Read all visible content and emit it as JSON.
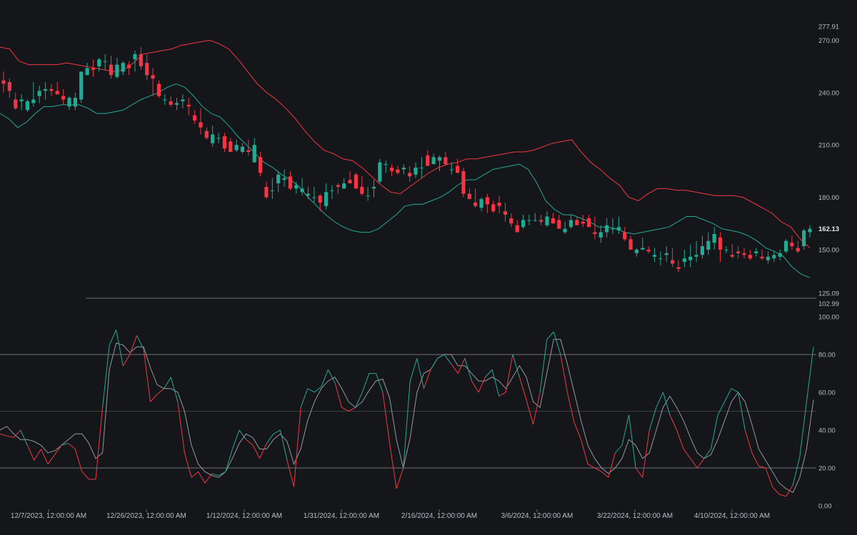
{
  "colors": {
    "background": "#151619",
    "up": "#22ab94",
    "down": "#f23645",
    "upper_band": "#f23645",
    "lower_band": "#22ab94",
    "k_up": "#22ab94",
    "k_down": "#f23645",
    "d_line": "#9598a1",
    "level_line": "#787b86"
  },
  "chart_data": [
    {
      "type": "candlestick",
      "panel": "price",
      "y_ticks": [
        "277.91",
        "270.00",
        "240.00",
        "210.00",
        "180.00",
        "150.00",
        "125.09"
      ],
      "ylim": [
        125.09,
        277.91
      ],
      "last_price_label": "162.13",
      "ohlc": [
        [
          247,
          252,
          240,
          245
        ],
        [
          246,
          248,
          237,
          241
        ],
        [
          236,
          240,
          230,
          231
        ],
        [
          235,
          239,
          230,
          236
        ],
        [
          230,
          236,
          229,
          235
        ],
        [
          234,
          246,
          232,
          236
        ],
        [
          238,
          244,
          234,
          241
        ],
        [
          241,
          246,
          236,
          242
        ],
        [
          242,
          245,
          238,
          241
        ],
        [
          241,
          246,
          239,
          239
        ],
        [
          238,
          242,
          233,
          236
        ],
        [
          232,
          238,
          230,
          237
        ],
        [
          232,
          240,
          230,
          237
        ],
        [
          236,
          250,
          234,
          252
        ],
        [
          250,
          257,
          250,
          254
        ],
        [
          254,
          259,
          249,
          253
        ],
        [
          255,
          260,
          252,
          259
        ],
        [
          258,
          262,
          253,
          258
        ],
        [
          256,
          261,
          248,
          250
        ],
        [
          249,
          260,
          248,
          256
        ],
        [
          252,
          258,
          250,
          257
        ],
        [
          256,
          258,
          250,
          254
        ],
        [
          259,
          264,
          252,
          262
        ],
        [
          262,
          266,
          253,
          255
        ],
        [
          257,
          262,
          247,
          250
        ],
        [
          250,
          254,
          238,
          248
        ],
        [
          245,
          247,
          237,
          238
        ],
        [
          236,
          239,
          233,
          236
        ],
        [
          235,
          238,
          232,
          233
        ],
        [
          233,
          237,
          230,
          234
        ],
        [
          235,
          239,
          231,
          236
        ],
        [
          233,
          237,
          227,
          232
        ],
        [
          227,
          230,
          222,
          224
        ],
        [
          223,
          231,
          216,
          220
        ],
        [
          218,
          220,
          213,
          214
        ],
        [
          211,
          221,
          209,
          216
        ],
        [
          214,
          217,
          211,
          214
        ],
        [
          215,
          217,
          206,
          208
        ],
        [
          212,
          214,
          208,
          206
        ],
        [
          207,
          213,
          206,
          210
        ],
        [
          206,
          211,
          205,
          209
        ],
        [
          207,
          213,
          204,
          206
        ],
        [
          200,
          214,
          204,
          210
        ],
        [
          203,
          206,
          192,
          194
        ],
        [
          186,
          189,
          179,
          180
        ],
        [
          184,
          191,
          179,
          184
        ],
        [
          188,
          195,
          183,
          193
        ],
        [
          190,
          196,
          186,
          191
        ],
        [
          192,
          195,
          184,
          185
        ],
        [
          185,
          189,
          182,
          187
        ],
        [
          183,
          191,
          181,
          185
        ],
        [
          181,
          186,
          179,
          182
        ],
        [
          180,
          186,
          177,
          180
        ],
        [
          181,
          182,
          172,
          177
        ],
        [
          175,
          188,
          173,
          183
        ],
        [
          184,
          187,
          179,
          184
        ],
        [
          187,
          188,
          182,
          186
        ],
        [
          185,
          191,
          185,
          188
        ],
        [
          190,
          195,
          189,
          188
        ],
        [
          193,
          194,
          187,
          185
        ],
        [
          186,
          192,
          181,
          182
        ],
        [
          181,
          186,
          178,
          181
        ],
        [
          185,
          190,
          180,
          186
        ],
        [
          189,
          202,
          188,
          200
        ],
        [
          199,
          201,
          194,
          199
        ],
        [
          197,
          199,
          192,
          195
        ],
        [
          196,
          198,
          193,
          194
        ],
        [
          196,
          199,
          193,
          197
        ],
        [
          194,
          198,
          189,
          192
        ],
        [
          193,
          200,
          191,
          197
        ],
        [
          197,
          203,
          191,
          197
        ],
        [
          204,
          207,
          200,
          198
        ],
        [
          199,
          205,
          199,
          203
        ],
        [
          201,
          204,
          195,
          203
        ],
        [
          203,
          206,
          198,
          199
        ],
        [
          196,
          200,
          193,
          196
        ],
        [
          198,
          202,
          195,
          194
        ],
        [
          195,
          197,
          180,
          182
        ],
        [
          182,
          185,
          179,
          179
        ],
        [
          177,
          185,
          174,
          175
        ],
        [
          174,
          180,
          172,
          179
        ],
        [
          180,
          182,
          171,
          176
        ],
        [
          176,
          178,
          171,
          172
        ],
        [
          177,
          181,
          171,
          175
        ],
        [
          172,
          177,
          166,
          170
        ],
        [
          168,
          171,
          163,
          165
        ],
        [
          164,
          167,
          161,
          160
        ],
        [
          163,
          170,
          162,
          167
        ],
        [
          167,
          170,
          164,
          167
        ],
        [
          167,
          171,
          166,
          167
        ],
        [
          167,
          170,
          164,
          166
        ],
        [
          164,
          172,
          163,
          169
        ],
        [
          168,
          171,
          166,
          165
        ],
        [
          167,
          170,
          163,
          162
        ],
        [
          160,
          166,
          159,
          162
        ],
        [
          163,
          170,
          162,
          167
        ],
        [
          167,
          169,
          165,
          164
        ],
        [
          166,
          170,
          163,
          165
        ],
        [
          168,
          170,
          164,
          163
        ],
        [
          160,
          169,
          156,
          159
        ],
        [
          157,
          164,
          154,
          160
        ],
        [
          160,
          168,
          157,
          164
        ],
        [
          162,
          168,
          159,
          162
        ],
        [
          161,
          169,
          159,
          163
        ],
        [
          160,
          163,
          155,
          156
        ],
        [
          156,
          158,
          152,
          150
        ],
        [
          148,
          151,
          146,
          150
        ],
        [
          150,
          157,
          150,
          151
        ],
        [
          150,
          152,
          148,
          149
        ],
        [
          146,
          151,
          143,
          147
        ],
        [
          145,
          149,
          141,
          145
        ],
        [
          147,
          152,
          143,
          148
        ],
        [
          144,
          151,
          140,
          142
        ],
        [
          140,
          144,
          137,
          139
        ],
        [
          143,
          150,
          140,
          145
        ],
        [
          144,
          153,
          140,
          146
        ],
        [
          146,
          155,
          143,
          147
        ],
        [
          147,
          158,
          145,
          152
        ],
        [
          150,
          160,
          147,
          155
        ],
        [
          154,
          163,
          150,
          159
        ],
        [
          157,
          160,
          143,
          150
        ],
        [
          150,
          152,
          148,
          150
        ],
        [
          147,
          153,
          145,
          146
        ],
        [
          149,
          152,
          145,
          148
        ],
        [
          148,
          151,
          145,
          147
        ],
        [
          147,
          150,
          144,
          145
        ],
        [
          148,
          151,
          146,
          149
        ],
        [
          146,
          150,
          144,
          145
        ],
        [
          144,
          149,
          142,
          146
        ],
        [
          145,
          149,
          143,
          147
        ],
        [
          146,
          150,
          144,
          148
        ],
        [
          149,
          156,
          148,
          155
        ],
        [
          154,
          158,
          150,
          152
        ],
        [
          151,
          155,
          148,
          149
        ],
        [
          152,
          162,
          150,
          161
        ],
        [
          160,
          164,
          157,
          162
        ]
      ],
      "upper_band": [
        266,
        265,
        258,
        256,
        256,
        256,
        256,
        257,
        256,
        255,
        254,
        253,
        252,
        253,
        257,
        262,
        263,
        264,
        265,
        267,
        268,
        269,
        270,
        268,
        265,
        259,
        252,
        245,
        240,
        236,
        231,
        225,
        218,
        212,
        207,
        205,
        202,
        201,
        197,
        192,
        187,
        183,
        182,
        186,
        190,
        194,
        197,
        199,
        200,
        202,
        202,
        203,
        204,
        205,
        206,
        206,
        207,
        209,
        211,
        212,
        213,
        206,
        200,
        196,
        191,
        187,
        180,
        178,
        182,
        185,
        185,
        184,
        184,
        183,
        182,
        181,
        181,
        181,
        180,
        177,
        174,
        171,
        166,
        163,
        156,
        151
      ],
      "lower_band": [
        228,
        225,
        220,
        223,
        228,
        232,
        232,
        233,
        233,
        233,
        231,
        228,
        228,
        229,
        230,
        233,
        236,
        238,
        240,
        243,
        245,
        243,
        238,
        232,
        228,
        226,
        221,
        215,
        210,
        205,
        200,
        197,
        193,
        190,
        186,
        180,
        175,
        170,
        166,
        163,
        161,
        160,
        160,
        162,
        166,
        170,
        175,
        176,
        176,
        178,
        180,
        183,
        187,
        190,
        190,
        193,
        196,
        197,
        198,
        199,
        196,
        188,
        178,
        173,
        170,
        170,
        168,
        166,
        163,
        163,
        162,
        160,
        159,
        160,
        161,
        162,
        163,
        166,
        169,
        169,
        167,
        165,
        162,
        161,
        160,
        158,
        155,
        151,
        149,
        146,
        140,
        136,
        134
      ]
    },
    {
      "type": "line",
      "panel": "stochastic",
      "y_ticks": [
        "102.99",
        "100.00",
        "80.00",
        "60.00",
        "40.00",
        "20.00",
        "0.00"
      ],
      "ylim": [
        0,
        102.99
      ],
      "levels": [
        80,
        50,
        20
      ],
      "series": [
        {
          "values": [
            38,
            37,
            36,
            40,
            32,
            24,
            30,
            22,
            27,
            32,
            33,
            30,
            18,
            14,
            14,
            52,
            85,
            93,
            74,
            80,
            90,
            83,
            55,
            59,
            62,
            68,
            55,
            28,
            15,
            18,
            12,
            17,
            16,
            18,
            30,
            40,
            35,
            32,
            25,
            33,
            38,
            40,
            24,
            10,
            52,
            62,
            60,
            63,
            72,
            65,
            52,
            50,
            52,
            60,
            70,
            70,
            60,
            33,
            9,
            20,
            66,
            78,
            62,
            72,
            78,
            80,
            75,
            70,
            78,
            66,
            60,
            68,
            72,
            58,
            60,
            80,
            68,
            56,
            43,
            60,
            88,
            92,
            80,
            60,
            44,
            35,
            22,
            20,
            18,
            15,
            28,
            32,
            48,
            20,
            15,
            40,
            52,
            60,
            48,
            40,
            30,
            25,
            20,
            25,
            30,
            48,
            55,
            62,
            60,
            40,
            28,
            21,
            20,
            10,
            6,
            5,
            11,
            26,
            55,
            84
          ]
        },
        {
          "values": [
            40,
            42,
            38,
            35,
            35,
            34,
            32,
            28,
            29,
            32,
            35,
            38,
            38,
            33,
            25,
            28,
            72,
            86,
            85,
            81,
            84,
            84,
            73,
            64,
            62,
            62,
            60,
            50,
            32,
            22,
            18,
            16,
            15,
            18,
            25,
            33,
            38,
            36,
            30,
            30,
            35,
            38,
            34,
            22,
            30,
            45,
            55,
            62,
            66,
            68,
            62,
            55,
            52,
            55,
            61,
            66,
            67,
            57,
            35,
            20,
            36,
            60,
            70,
            72,
            78,
            80,
            80,
            74,
            74,
            70,
            66,
            66,
            68,
            66,
            62,
            68,
            74,
            68,
            55,
            52,
            70,
            88,
            88,
            75,
            60,
            45,
            32,
            25,
            20,
            17,
            20,
            25,
            35,
            32,
            25,
            28,
            40,
            52,
            58,
            52,
            45,
            36,
            28,
            25,
            27,
            35,
            45,
            55,
            60,
            55,
            43,
            30,
            24,
            18,
            12,
            9,
            7,
            15,
            30,
            56
          ]
        }
      ]
    }
  ],
  "x_axis": {
    "labels": [
      "12/7/2023, 12:00:00 AM",
      "12/26/2023, 12:00:00 AM",
      "1/12/2024, 12:00:00 AM",
      "1/31/2024, 12:00:00 AM",
      "2/16/2024, 12:00:00 AM",
      "3/6/2024, 12:00:00 AM",
      "3/22/2024, 12:00:00 AM",
      "4/10/2024, 12:00:00 AM"
    ]
  }
}
